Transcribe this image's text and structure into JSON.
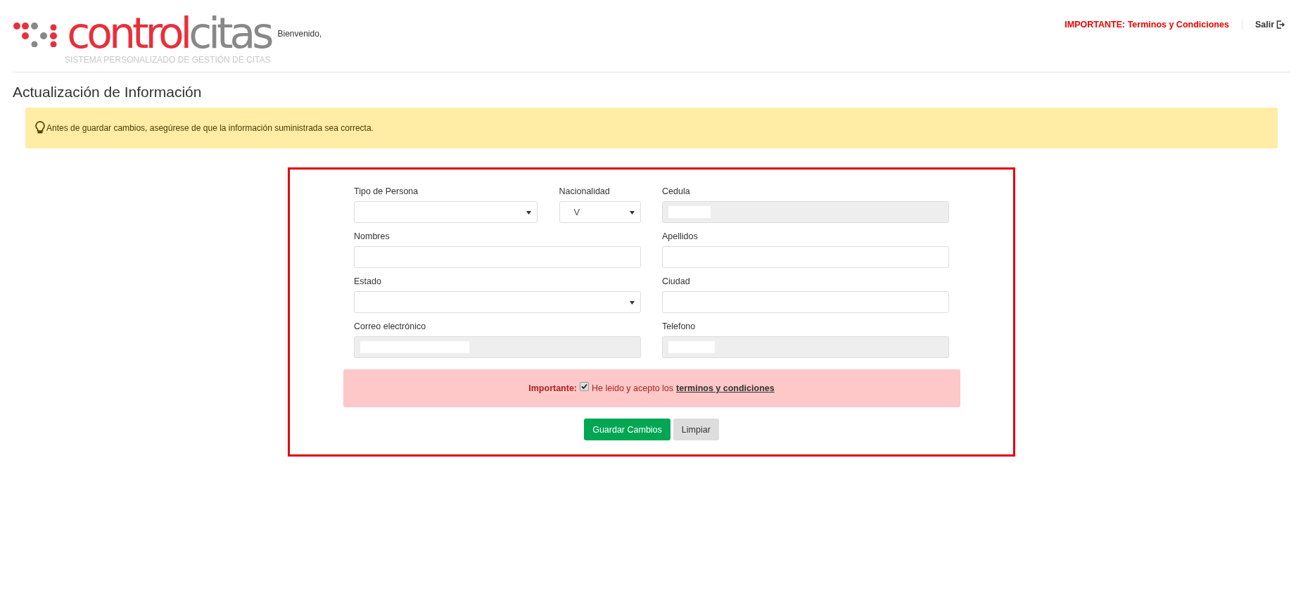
{
  "header": {
    "logo": {
      "word_1": "control",
      "word_2": "citas",
      "tagline": "SISTEMA PERSONALIZADO DE GESTIÓN DE CITAS"
    },
    "greeting": "Bienvenido,",
    "terms_link": "IMPORTANTE: Terminos y Condiciones",
    "logout": "Salir"
  },
  "page_title": "Actualización de Información",
  "notice": "Antes de guardar cambios, asegúrese de que la información suministrada sea correcta.",
  "form": {
    "rows": [
      [
        {
          "label": "Tipo de Persona",
          "kind": "select",
          "disabled": false
        },
        {
          "label": "Nacionalidad",
          "kind": "select",
          "value": "V",
          "disabled": false
        },
        {
          "label": "Cedula",
          "kind": "text",
          "disabled": true,
          "value_hidden": true
        }
      ],
      [
        {
          "label": "Nombres",
          "kind": "text",
          "disabled": false
        },
        {
          "label": "Apellidos",
          "kind": "text",
          "disabled": false
        }
      ],
      [
        {
          "label": "Estado",
          "kind": "select",
          "disabled": false
        },
        {
          "label": "Ciudad",
          "kind": "text",
          "disabled": false
        }
      ],
      [
        {
          "label": "Correo electrónico",
          "kind": "text",
          "disabled": true,
          "value_hidden": true
        },
        {
          "label": "Telefono",
          "kind": "text",
          "disabled": true,
          "value_hidden": true
        }
      ]
    ],
    "agreement": {
      "label": "Importante:",
      "text": "He leido y acepto los",
      "link": "terminos y condiciones",
      "checked": true
    },
    "buttons": [
      {
        "label": "Guardar Cambios",
        "kind": "primary"
      },
      {
        "label": "Limpiar",
        "kind": "secondary"
      }
    ]
  }
}
